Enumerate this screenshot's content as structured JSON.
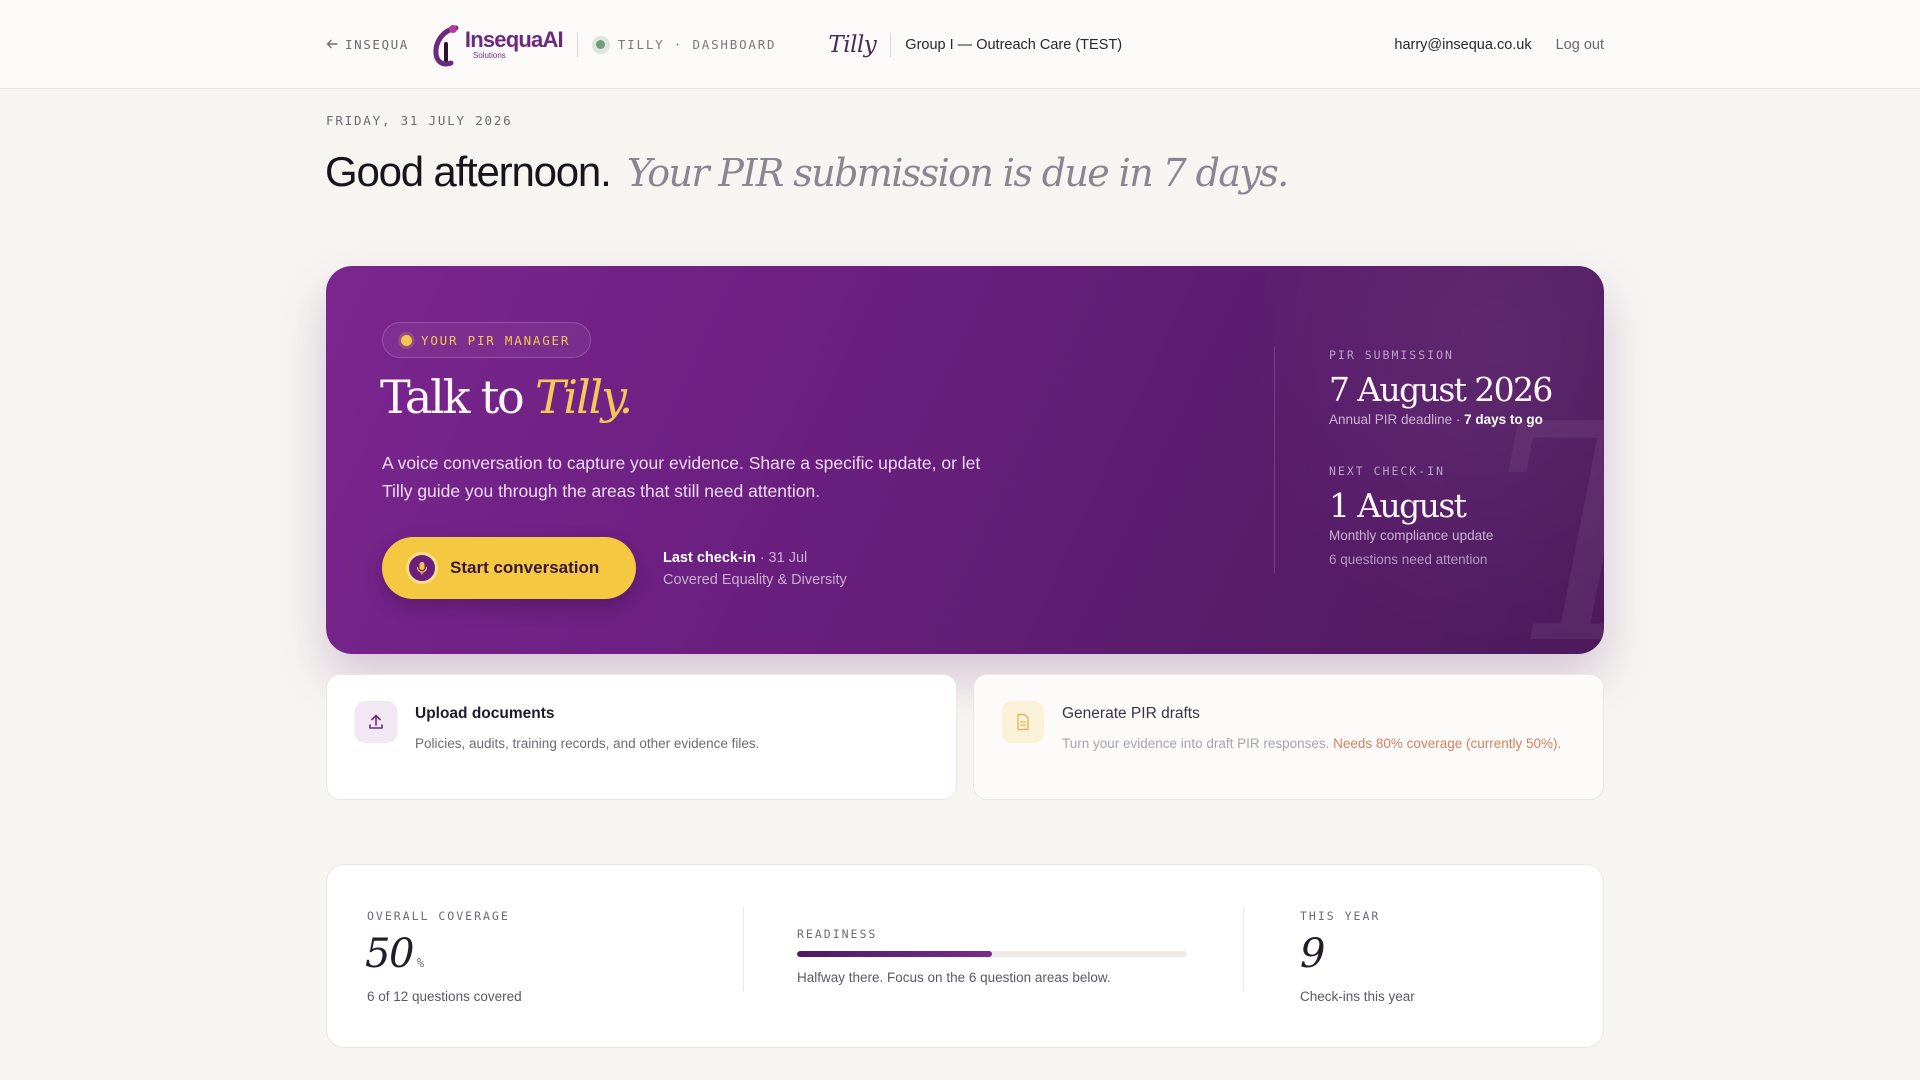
{
  "topbar": {
    "back_label": "INSEQUA",
    "logo_name_a": "Insequa",
    "logo_name_b": "AI",
    "logo_sub": "Solutions",
    "crumb": "TILLY · DASHBOARD",
    "tilly": "Tilly",
    "org": "Group I — Outreach Care (TEST)",
    "email": "harry@insequa.co.uk",
    "logout": "Log out"
  },
  "header": {
    "date": "FRIDAY, 31 JULY 2026",
    "greeting": "Good afternoon.",
    "subtitle": "Your PIR submission is due in 7 days."
  },
  "hero": {
    "pill": "YOUR PIR MANAGER",
    "title_a": "Talk to ",
    "title_b": "Tilly.",
    "description": "A voice conversation to capture your evidence. Share a specific update, or let Tilly guide you through the areas that still need attention.",
    "start_button": "Start conversation",
    "last_checkin_label": "Last check-in",
    "last_checkin_date": " · 31 Jul",
    "last_checkin_covered": "Covered Equality & Diversity",
    "pir_submission": {
      "label": "PIR SUBMISSION",
      "value": "7 August 2026",
      "sub_a": "Annual PIR deadline · ",
      "sub_b": "7 days to go"
    },
    "next_checkin": {
      "label": "NEXT CHECK-IN",
      "value": "1 August",
      "sub": "Monthly compliance update",
      "sub2": "6 questions need attention"
    }
  },
  "actions": {
    "upload": {
      "title": "Upload documents",
      "subtitle": "Policies, audits, training records, and other evidence files."
    },
    "generate": {
      "title": "Generate PIR drafts",
      "subtitle": "Turn your evidence into draft PIR responses. ",
      "warning": "Needs 80% coverage (currently 50%)."
    }
  },
  "stats": {
    "coverage": {
      "label": "OVERALL COVERAGE",
      "value": "50",
      "unit": "%",
      "sub": "6 of 12 questions covered"
    },
    "readiness": {
      "label": "READINESS",
      "fraction": 0.5,
      "sub": "Halfway there. Focus on the 6 question areas below."
    },
    "this_year": {
      "label": "THIS YEAR",
      "value": "9",
      "sub": "Check-ins this year"
    }
  },
  "colors": {
    "accent_purple": "#6a1f7f",
    "accent_yellow": "#f5c842",
    "warning": "#d4805d"
  }
}
